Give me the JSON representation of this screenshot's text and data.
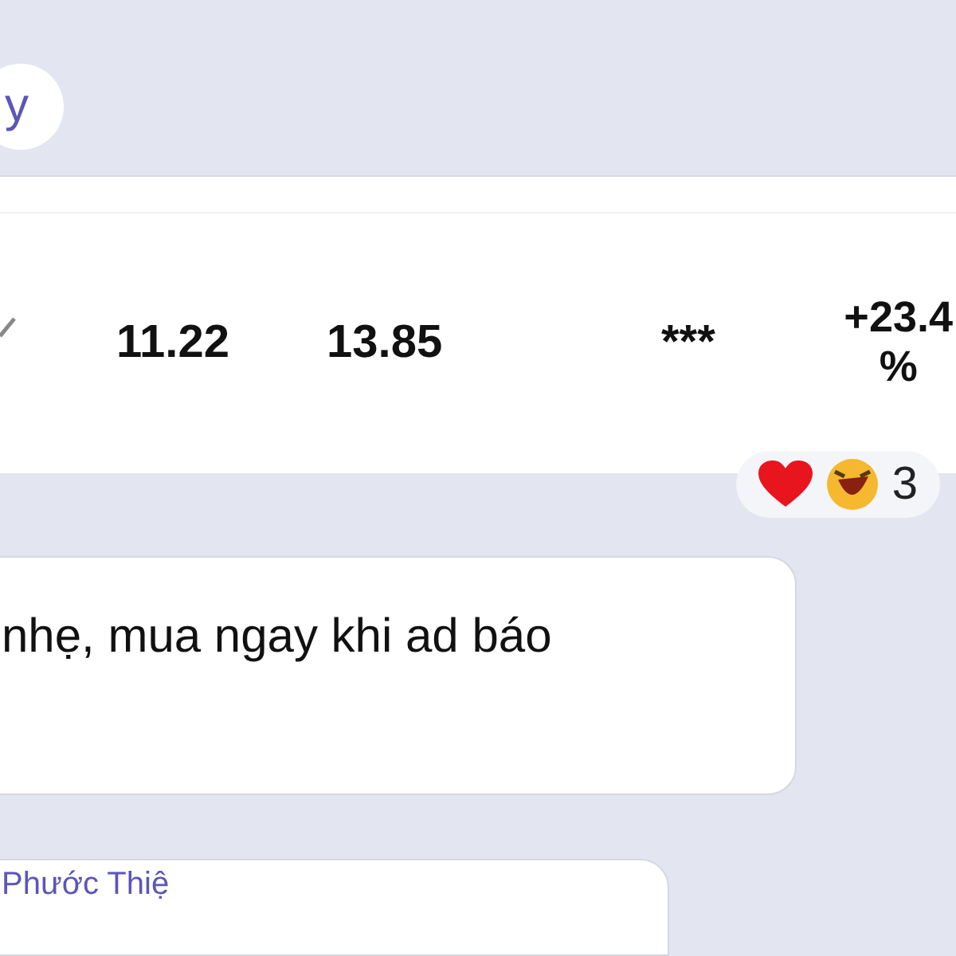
{
  "top_bubble": {
    "text": "y"
  },
  "table_row": {
    "checked": true,
    "cells": [
      "11.22",
      "13.85",
      "***"
    ],
    "change": [
      "+23.4",
      "%"
    ]
  },
  "reactions": {
    "count": "3"
  },
  "message": {
    "text": "nhẹ, mua ngay khi ad báo"
  },
  "next_message": {
    "sender": "Phước Thiệ"
  }
}
